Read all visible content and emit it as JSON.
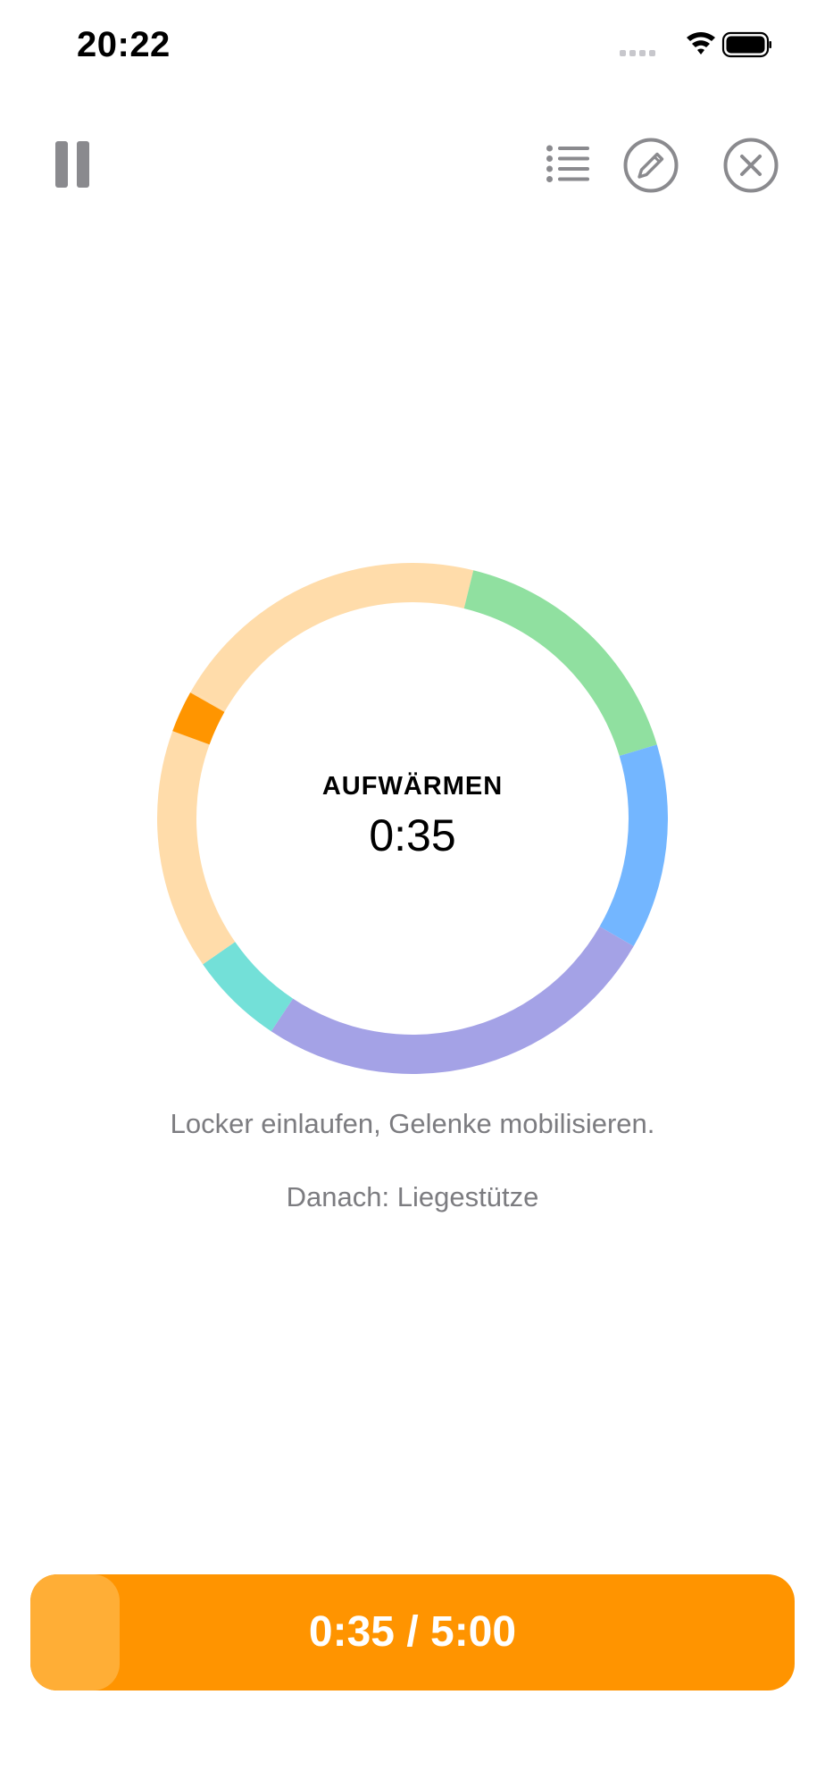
{
  "status_bar": {
    "time": "20:22",
    "icons": [
      "signal-icon",
      "wifi-icon",
      "battery-icon"
    ]
  },
  "toolbar": {
    "left": [
      "pause-icon"
    ],
    "right": [
      "list-icon",
      "edit-icon",
      "close-icon"
    ]
  },
  "timer": {
    "phase": "AUFWÄRMEN",
    "phase_time": "0:35",
    "description": "Locker einlaufen, Gelenke mobilisieren.",
    "next": "Danach: Liegestütze",
    "segments": [
      {
        "color": "#ffdcaa",
        "fraction": 0.205,
        "active": true
      },
      {
        "color": "#90e0a0",
        "fraction": 0.165
      },
      {
        "color": "#73b6ff",
        "fraction": 0.13
      },
      {
        "color": "#a4a2e6",
        "fraction": 0.26
      },
      {
        "color": "#73e0d8",
        "fraction": 0.06
      },
      {
        "color": "#ffdcaa",
        "fraction": 0.18
      }
    ],
    "position_marker_color": "#ff9500"
  },
  "progress": {
    "label": "0:35 / 5:00",
    "elapsed_fraction": 0.1167,
    "bar_color": "#ff9400",
    "fill_color": "#ffae36"
  }
}
